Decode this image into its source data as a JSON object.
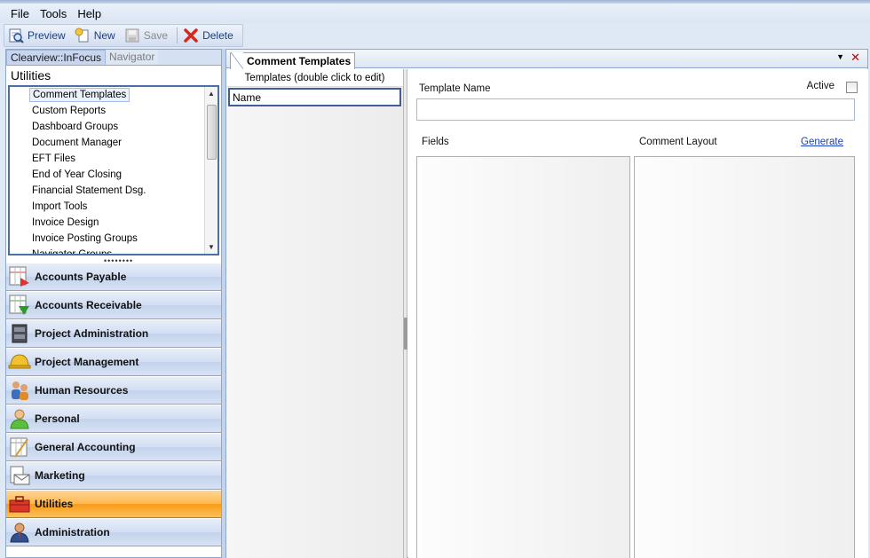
{
  "menu": {
    "file": "File",
    "tools": "Tools",
    "help": "Help"
  },
  "toolbar": {
    "preview": "Preview",
    "new": "New",
    "save": "Save",
    "delete": "Delete"
  },
  "left": {
    "tabs": [
      "Clearview::InFocus",
      "Navigator"
    ],
    "section_title": "Utilities",
    "utility_items": [
      "Comment Templates",
      "Custom Reports",
      "Dashboard Groups",
      "Document Manager",
      "EFT Files",
      "End of Year Closing",
      "Financial Statement Dsg.",
      "Import Tools",
      "Invoice Design",
      "Invoice Posting Groups",
      "Navigator Groups"
    ],
    "selected_item": "Comment Templates",
    "nav_buttons": [
      "Accounts Payable",
      "Accounts Receivable",
      "Project Administration",
      "Project Management",
      "Human Resources",
      "Personal",
      "General Accounting",
      "Marketing",
      "Utilities",
      "Administration"
    ],
    "active_nav": "Utilities"
  },
  "document": {
    "tab_title": "Comment Templates",
    "templates_header": "Templates (double click to edit)",
    "column_name": "Name",
    "template_name_label": "Template Name",
    "active_label": "Active",
    "fields_label": "Fields",
    "comment_layout_label": "Comment Layout",
    "generate_link": "Generate"
  },
  "colors": {
    "accent": "#4b6fa7",
    "active_nav": "#f89b17",
    "close_icon": "#c00000",
    "link": "#1a3fbf"
  }
}
